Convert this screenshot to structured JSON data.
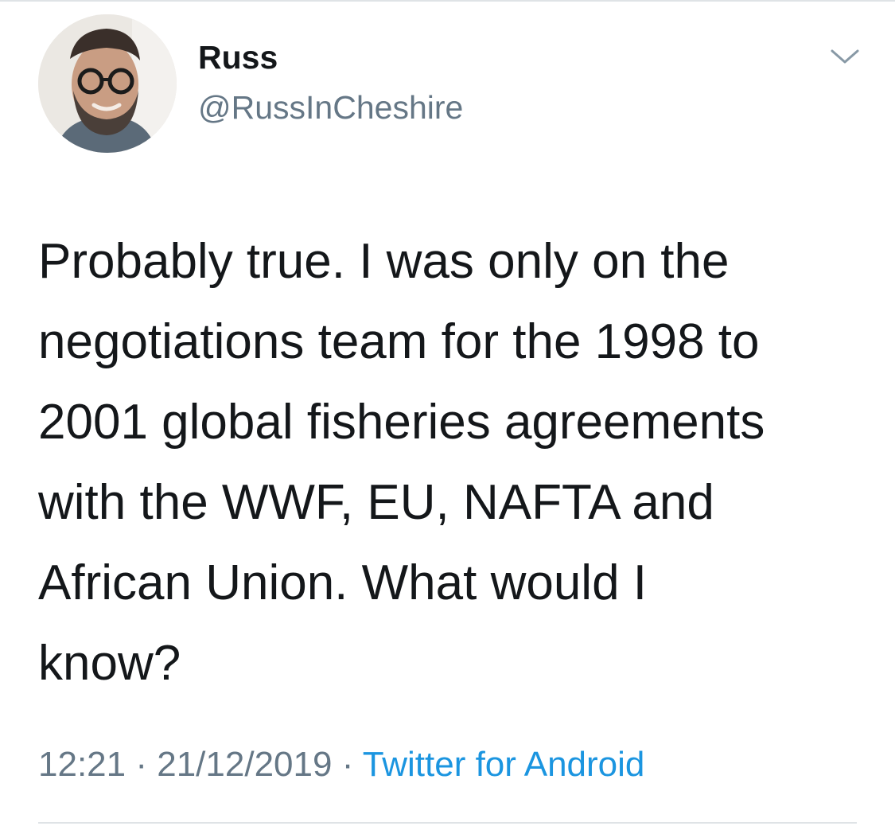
{
  "author": {
    "display_name": "Russ",
    "handle": "@RussInCheshire"
  },
  "tweet": {
    "lines": [
      "Probably true. I was only on the",
      "negotiations team for the 1998 to",
      "2001 global fisheries agreements",
      "with the WWF, EU, NAFTA and",
      "African Union. What would I",
      "know?"
    ]
  },
  "meta": {
    "time": "12:21",
    "separator": "·",
    "date": "21/12/2019",
    "source": "Twitter for Android"
  },
  "icons": {
    "menu": "chevron-down-icon",
    "avatar": "profile-photo"
  },
  "colors": {
    "text": "#14171a",
    "secondary": "#657786",
    "link": "#1b95e0",
    "divider": "#dfe3e6"
  }
}
